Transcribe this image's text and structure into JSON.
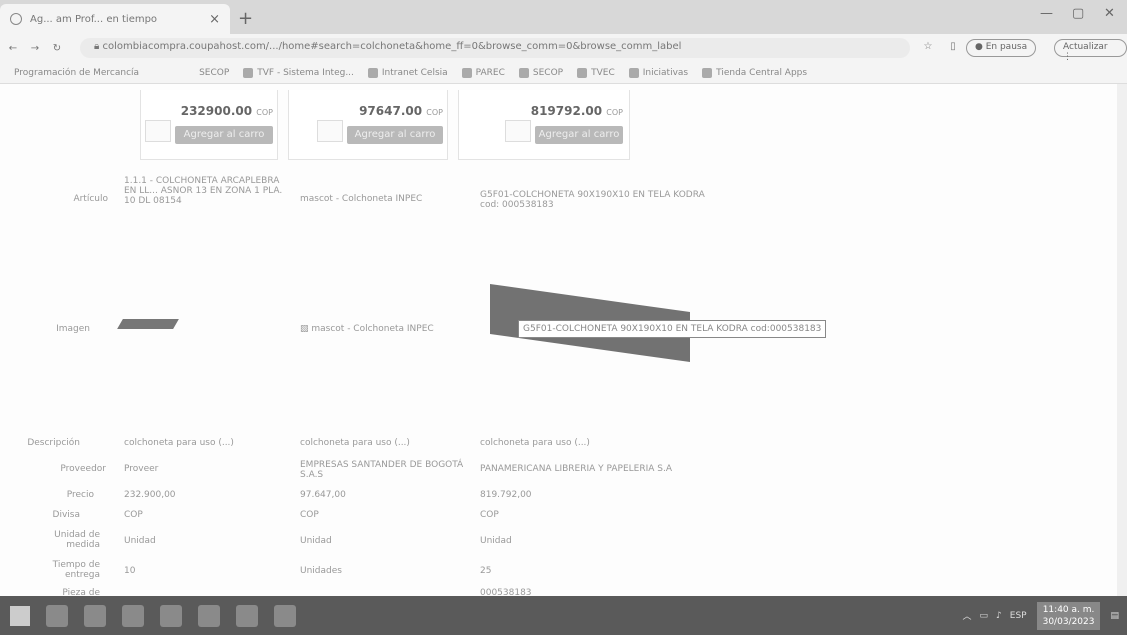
{
  "browser": {
    "tab_title": "Ag... am Prof... en tiempo",
    "url": "colombiacompra.coupahost.com/.../home#search=colchoneta&home_ff=0&browse_comm=0&browse_comm_label",
    "paused_label": "En pausa",
    "update_label": "Actualizar"
  },
  "bookmarks": [
    "Programación de Mercancía",
    "SECOP",
    "TVF - Sistema Integ...",
    "Intranet Celsia",
    "PAREC",
    "SECOP",
    "TVEC",
    "Iniciativas",
    "Tienda Central Apps"
  ],
  "prices": [
    {
      "amount": "232900.00",
      "currency": "COP",
      "button": "Agregar al carro"
    },
    {
      "amount": "97647.00",
      "currency": "COP",
      "button": "Agregar al carro"
    },
    {
      "amount": "819792.00",
      "currency": "COP",
      "button": "Agregar al carro"
    }
  ],
  "labels": {
    "articulo": "Artículo",
    "imagen": "Imagen",
    "descripcion": "Descripción",
    "proveedor": "Proveedor",
    "precio": "Precio",
    "divisa": "Divisa",
    "unidad": "Unidad de medida",
    "tiempo": "Tiempo de entrega",
    "pieza": "Pieza de"
  },
  "products": [
    {
      "articulo": "1.1.1 - COLCHONETA ARCAPLEBRA EN LL... ASNOR 13 EN ZONA 1 PLA. 10 DL 08154",
      "imagen": "",
      "descripcion": "colchoneta para uso (...)",
      "proveedor": "Proveer",
      "precio": "232.900,00",
      "divisa": "COP",
      "unidad": "Unidad",
      "tiempo": "10"
    },
    {
      "articulo": "mascot - Colchoneta INPEC",
      "imagen": "mascot - Colchoneta INPEC",
      "descripcion": "colchoneta para uso (...)",
      "proveedor": "EMPRESAS SANTANDER DE BOGOTÁ S.A.S",
      "precio": "97.647,00",
      "divisa": "COP",
      "unidad": "Unidad",
      "tiempo": "Unidades"
    },
    {
      "articulo": "G5F01-COLCHONETA 90X190X10 EN TELA KODRA",
      "articulo_code": "cod: 000538183",
      "imagen": "G5F01-COLCHONETA 90X190X10 EN TELA KODRA cod:000538183",
      "descripcion": "colchoneta para uso (...)",
      "proveedor": "PANAMERICANA LIBRERIA Y PAPELERIA S.A",
      "precio": "819.792,00",
      "divisa": "COP",
      "unidad": "Unidad",
      "tiempo": "25",
      "pieza": "000538183"
    }
  ],
  "taskbar": {
    "lang": "ESP",
    "time": "11:40 a. m.",
    "date": "30/03/2023"
  }
}
